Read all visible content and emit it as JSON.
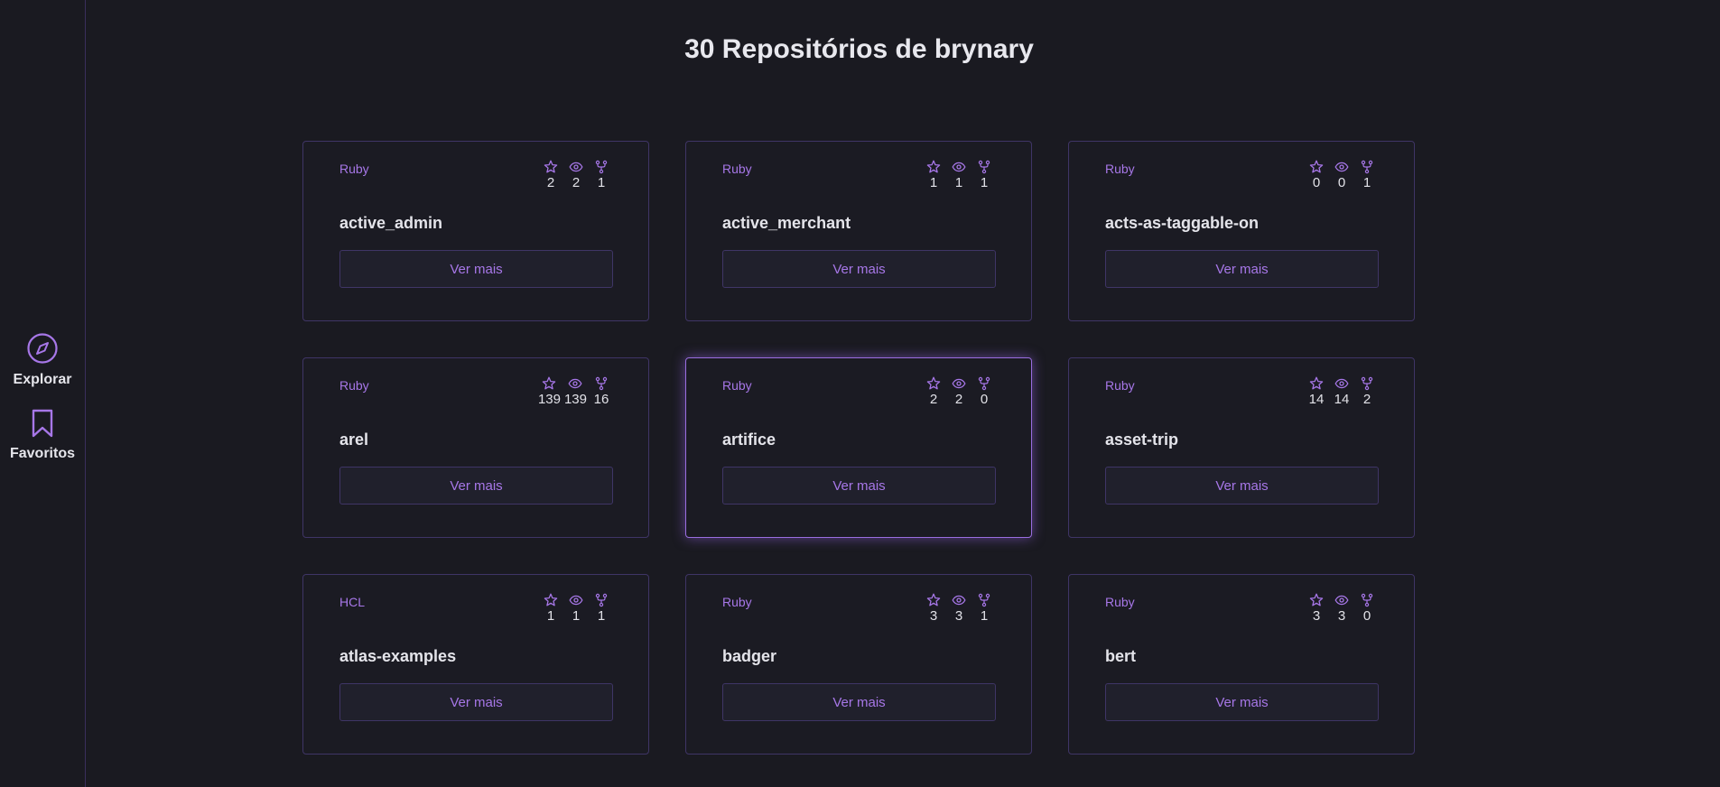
{
  "sidebar": {
    "items": [
      {
        "label": "Explorar",
        "icon": "compass-icon"
      },
      {
        "label": "Favoritos",
        "icon": "bookmark-icon"
      }
    ]
  },
  "page": {
    "title": "30 Repositórios de brynary"
  },
  "accent_color": "#a777e8",
  "stat_icons": [
    "star-icon",
    "eye-icon",
    "fork-icon"
  ],
  "repos": [
    {
      "name": "active_admin",
      "language": "Ruby",
      "stars": "2",
      "watchers": "2",
      "forks": "1",
      "button": "Ver mais"
    },
    {
      "name": "active_merchant",
      "language": "Ruby",
      "stars": "1",
      "watchers": "1",
      "forks": "1",
      "button": "Ver mais"
    },
    {
      "name": "acts-as-taggable-on",
      "language": "Ruby",
      "stars": "0",
      "watchers": "0",
      "forks": "1",
      "button": "Ver mais"
    },
    {
      "name": "arel",
      "language": "Ruby",
      "stars": "139",
      "watchers": "139",
      "forks": "16",
      "button": "Ver mais"
    },
    {
      "name": "artifice",
      "language": "Ruby",
      "stars": "2",
      "watchers": "2",
      "forks": "0",
      "button": "Ver mais"
    },
    {
      "name": "asset-trip",
      "language": "Ruby",
      "stars": "14",
      "watchers": "14",
      "forks": "2",
      "button": "Ver mais"
    },
    {
      "name": "atlas-examples",
      "language": "HCL",
      "stars": "1",
      "watchers": "1",
      "forks": "1",
      "button": "Ver mais"
    },
    {
      "name": "badger",
      "language": "Ruby",
      "stars": "3",
      "watchers": "3",
      "forks": "1",
      "button": "Ver mais"
    },
    {
      "name": "bert",
      "language": "Ruby",
      "stars": "3",
      "watchers": "3",
      "forks": "0",
      "button": "Ver mais"
    }
  ]
}
